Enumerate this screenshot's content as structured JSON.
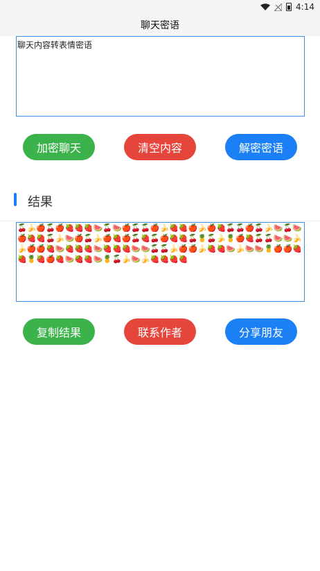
{
  "status_bar": {
    "time": "4:14"
  },
  "app_bar": {
    "title": "聊天密语"
  },
  "input": {
    "placeholder": "聊天内容转表情密语"
  },
  "actions_top": {
    "encrypt": "加密聊天",
    "clear": "清空内容",
    "decrypt": "解密密语"
  },
  "result_section": {
    "title": "结果"
  },
  "result": {
    "text": "🍒🍌🍎🍒🍎🍓🍓🍓🍉🍒🍉🍎🍒🍒🍎🍌🍓🍓🍎🍌🍎🍓🍒🍒🍎🍒🍌🍉🍒🍉🍎🍓🍓🍒🍌🍉🍎🍒🍌🍎🍓🍎🍒🍓🍒🍎🍓🍓🍒🍍🍒🍌🍍🍎🍓🍒🍒🍉🍉🍌🍌🍎🍎🍓🍉🍓🍓🍓🍉🍓🍓🍓🍉🍉🍒🍒🍌🍎🍎🍌🍓🍓🍉🍌🍉🍉🍍🍎🍎🍓🍓🍍🍓🍎🍓🍉🍓🍓🍉🍍🍒🍌🍉🍌🍓🍓🍓🍓"
  },
  "actions_bottom": {
    "copy": "复制结果",
    "contact": "联系作者",
    "share": "分享朋友"
  }
}
